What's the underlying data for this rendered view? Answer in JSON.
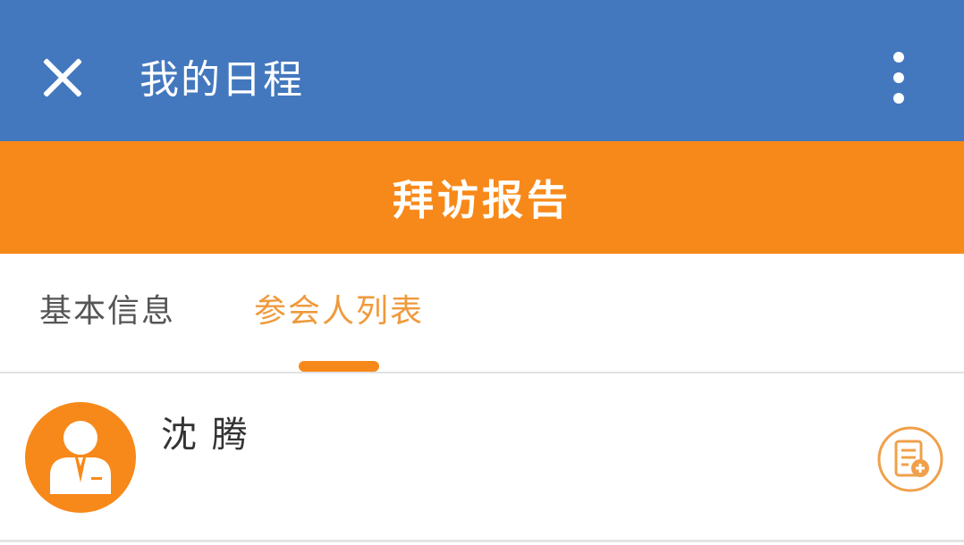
{
  "appbar": {
    "title": "我的日程",
    "close_icon": "close-icon",
    "more_icon": "more-vertical-icon",
    "background_color": "#4378be"
  },
  "banner": {
    "title": "拜访报告",
    "background_color": "#f7891a"
  },
  "tabs": [
    {
      "label": "基本信息",
      "active": false
    },
    {
      "label": "参会人列表",
      "active": true
    }
  ],
  "attendees": [
    {
      "name": "沈 腾",
      "avatar_icon": "person-icon",
      "action_icon": "add-report-icon"
    }
  ],
  "colors": {
    "accent": "#f7891a",
    "active_tab_text": "#ef9a3c"
  }
}
